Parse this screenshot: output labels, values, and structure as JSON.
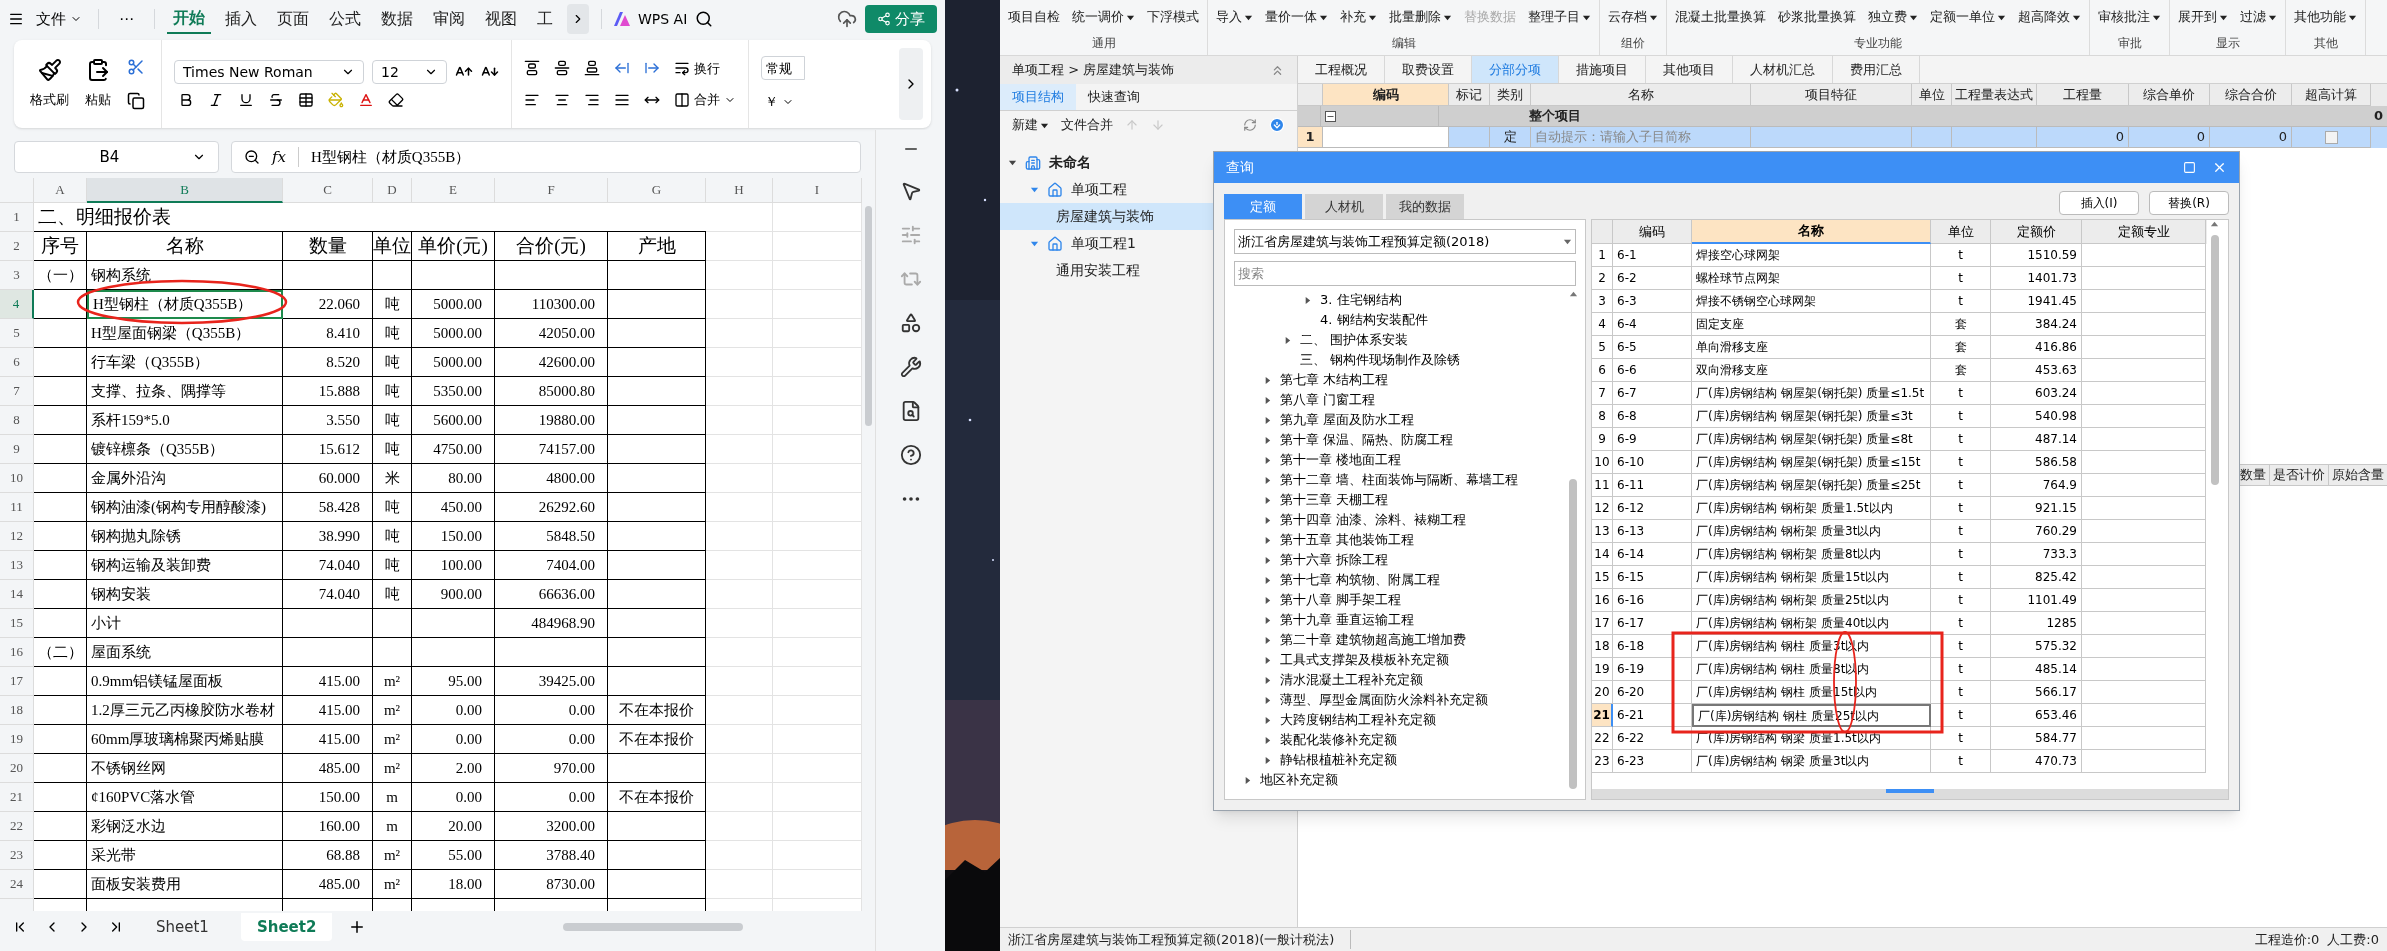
{
  "spreadsheet": {
    "menu": {
      "file": "文件",
      "more": "⋯"
    },
    "tabs": [
      {
        "label": "开始",
        "selected": true
      },
      {
        "label": "插入",
        "selected": false
      },
      {
        "label": "页面",
        "selected": false
      },
      {
        "label": "公式",
        "selected": false
      },
      {
        "label": "数据",
        "selected": false
      },
      {
        "label": "审阅",
        "selected": false
      },
      {
        "label": "视图",
        "selected": false
      },
      {
        "label": "工",
        "selected": false
      }
    ],
    "ai": "WPS AI",
    "share": "分享",
    "ribbon": {
      "format_painter": "格式刷",
      "paste": "粘贴",
      "font": "Times New Roman",
      "size": "12",
      "wrap": "换行",
      "merge": "合并",
      "number_format": "常规",
      "currency": "￥"
    },
    "name_box": "B4",
    "fx": "fx",
    "formula": "H型钢柱（材质Q355B）",
    "columns": [
      {
        "label": "A",
        "selected": false
      },
      {
        "label": "B",
        "selected": true
      },
      {
        "label": "C",
        "selected": false
      },
      {
        "label": "D",
        "selected": false
      },
      {
        "label": "E",
        "selected": false
      },
      {
        "label": "F",
        "selected": false
      },
      {
        "label": "G",
        "selected": false
      },
      {
        "label": "H",
        "selected": false
      },
      {
        "label": "I",
        "selected": false
      }
    ],
    "title_row": {
      "num": "1",
      "title": "二、明细报价表"
    },
    "header_row": {
      "num": "2",
      "seq": "序号",
      "name": "名称",
      "qty": "数量",
      "unit": "单位",
      "price": "单价(元)",
      "total": "合价(元)",
      "origin": "产地"
    },
    "rows": [
      {
        "num": "3",
        "selected": false,
        "seq": "（一）",
        "name": "钢构系统"
      },
      {
        "num": "4",
        "selected": true,
        "name": "H型钢柱（材质Q355B）",
        "qty": "22.060",
        "unit": "吨",
        "price": "5000.00",
        "total": "110300.00"
      },
      {
        "num": "5",
        "selected": false,
        "name": "H型屋面钢梁（Q355B）",
        "qty": "8.410",
        "unit": "吨",
        "price": "5000.00",
        "total": "42050.00"
      },
      {
        "num": "6",
        "selected": false,
        "name": "行车梁（Q355B）",
        "qty": "8.520",
        "unit": "吨",
        "price": "5000.00",
        "total": "42600.00"
      },
      {
        "num": "7",
        "selected": false,
        "name": "支撑、拉条、隅撑等",
        "qty": "15.888",
        "unit": "吨",
        "price": "5350.00",
        "total": "85000.80"
      },
      {
        "num": "8",
        "selected": false,
        "name": "系杆159*5.0",
        "qty": "3.550",
        "unit": "吨",
        "price": "5600.00",
        "total": "19880.00"
      },
      {
        "num": "9",
        "selected": false,
        "name": "镀锌檩条（Q355B）",
        "qty": "15.612",
        "unit": "吨",
        "price": "4750.00",
        "total": "74157.00"
      },
      {
        "num": "10",
        "selected": false,
        "name": "金属外沿沟",
        "qty": "60.000",
        "unit": "米",
        "price": "80.00",
        "total": "4800.00"
      },
      {
        "num": "11",
        "selected": false,
        "name": "钢构油漆(钢构专用醇酸漆)",
        "qty": "58.428",
        "unit": "吨",
        "price": "450.00",
        "total": "26292.60"
      },
      {
        "num": "12",
        "selected": false,
        "name": "钢构抛丸除锈",
        "qty": "38.990",
        "unit": "吨",
        "price": "150.00",
        "total": "5848.50"
      },
      {
        "num": "13",
        "selected": false,
        "name": "钢构运输及装卸费",
        "qty": "74.040",
        "unit": "吨",
        "price": "100.00",
        "total": "7404.00"
      },
      {
        "num": "14",
        "selected": false,
        "name": "钢构安装",
        "qty": "74.040",
        "unit": "吨",
        "price": "900.00",
        "total": "66636.00"
      },
      {
        "num": "15",
        "selected": false,
        "name": "小计",
        "total": "484968.90"
      },
      {
        "num": "16",
        "selected": false,
        "seq": "（二）",
        "name": "屋面系统"
      },
      {
        "num": "17",
        "selected": false,
        "name": "0.9mm铝镁锰屋面板",
        "qty": "415.00",
        "unit": "m²",
        "price": "95.00",
        "total": "39425.00"
      },
      {
        "num": "18",
        "selected": false,
        "name": "1.2厚三元乙丙橡胶防水卷材",
        "qty": "415.00",
        "unit": "m²",
        "price": "0.00",
        "total": "0.00",
        "origin": "不在本报价"
      },
      {
        "num": "19",
        "selected": false,
        "name": "60mm厚玻璃棉聚丙烯贴膜",
        "qty": "415.00",
        "unit": "m²",
        "price": "0.00",
        "total": "0.00",
        "origin": "不在本报价"
      },
      {
        "num": "20",
        "selected": false,
        "name": "不锈钢丝网",
        "qty": "485.00",
        "unit": "m²",
        "price": "2.00",
        "total": "970.00"
      },
      {
        "num": "21",
        "selected": false,
        "name": "¢160PVC落水管",
        "qty": "150.00",
        "unit": "m",
        "price": "0.00",
        "total": "0.00",
        "origin": "不在本报价"
      },
      {
        "num": "22",
        "selected": false,
        "name": "彩钢泛水边",
        "qty": "160.00",
        "unit": "m",
        "price": "20.00",
        "total": "3200.00"
      },
      {
        "num": "23",
        "selected": false,
        "name": "采光带",
        "qty": "68.88",
        "unit": "m²",
        "price": "55.00",
        "total": "3788.40"
      },
      {
        "num": "24",
        "selected": false,
        "name": "面板安装费用",
        "qty": "485.00",
        "unit": "m²",
        "price": "18.00",
        "total": "8730.00"
      }
    ],
    "sheets": [
      {
        "label": "Sheet1",
        "selected": false
      },
      {
        "label": "Sheet2",
        "selected": true
      }
    ]
  },
  "estimator": {
    "ribbon_groups": [
      {
        "label": "通用",
        "buttons": [
          {
            "label": "项目自检",
            "dropdown": false,
            "disabled": false
          },
          {
            "label": "统一调价",
            "dropdown": true,
            "disabled": false
          },
          {
            "label": "下浮模式",
            "dropdown": false,
            "disabled": false
          }
        ]
      },
      {
        "label": "编辑",
        "buttons": [
          {
            "label": "导入",
            "dropdown": true,
            "disabled": false
          },
          {
            "label": "量价一体",
            "dropdown": true,
            "disabled": false
          },
          {
            "label": "补充",
            "dropdown": true,
            "disabled": false
          },
          {
            "label": "批量删除",
            "dropdown": true,
            "disabled": false
          },
          {
            "label": "替换数据",
            "dropdown": false,
            "disabled": true
          },
          {
            "label": "整理子目",
            "dropdown": true,
            "disabled": false
          }
        ]
      },
      {
        "label": "组价",
        "buttons": [
          {
            "label": "云存档",
            "dropdown": true,
            "disabled": false
          }
        ]
      },
      {
        "label": "专业功能",
        "buttons": [
          {
            "label": "混凝土批量换算",
            "dropdown": false,
            "disabled": false
          },
          {
            "label": "砂浆批量换算",
            "dropdown": false,
            "disabled": false
          },
          {
            "label": "独立费",
            "dropdown": true,
            "disabled": false
          },
          {
            "label": "定额一单位",
            "dropdown": true,
            "disabled": false
          },
          {
            "label": "超高降效",
            "dropdown": true,
            "disabled": false
          }
        ]
      },
      {
        "label": "审批",
        "buttons": [
          {
            "label": "审核批注",
            "dropdown": true,
            "disabled": false
          }
        ]
      },
      {
        "label": "显示",
        "buttons": [
          {
            "label": "展开到",
            "dropdown": true,
            "disabled": false
          },
          {
            "label": "过滤",
            "dropdown": true,
            "disabled": false
          }
        ]
      },
      {
        "label": "其他",
        "buttons": [
          {
            "label": "其他功能",
            "dropdown": true,
            "disabled": false
          }
        ]
      }
    ],
    "breadcrumb": "单项工程 > 房屋建筑与装饰",
    "side_tabs": [
      {
        "label": "项目结构",
        "selected": true
      },
      {
        "label": "快速查询",
        "selected": false
      }
    ],
    "side_actions": {
      "new": "新建",
      "merge": "文件合并"
    },
    "tree": [
      {
        "label": "未命名",
        "kind": "root",
        "selected": false,
        "expanded": true,
        "children": [
          {
            "label": "单项工程",
            "kind": "project",
            "selected": false,
            "expanded": true,
            "children": [
              {
                "label": "房屋建筑与装饰",
                "kind": "unit",
                "selected": true
              }
            ]
          },
          {
            "label": "单项工程1",
            "kind": "project",
            "selected": false,
            "expanded": true,
            "children": [
              {
                "label": "通用安装工程",
                "kind": "unit",
                "selected": false
              }
            ]
          }
        ]
      }
    ],
    "tabs": [
      {
        "label": "工程概况",
        "selected": false
      },
      {
        "label": "取费设置",
        "selected": false
      },
      {
        "label": "分部分项",
        "selected": true
      },
      {
        "label": "措施项目",
        "selected": false
      },
      {
        "label": "其他项目",
        "selected": false
      },
      {
        "label": "人材机汇总",
        "selected": false
      },
      {
        "label": "费用汇总",
        "selected": false
      }
    ],
    "grid": {
      "columns": [
        "编码",
        "标记",
        "类别",
        "名称",
        "项目特征",
        "单位",
        "工程量表达式",
        "工程量",
        "综合单价",
        "综合合价",
        "超高计算"
      ],
      "rows": [
        {
          "kind": "group",
          "selected": false,
          "name": "整个项目",
          "total": "0"
        },
        {
          "kind": "item",
          "selected": true,
          "num": "1",
          "type": "定",
          "name": "自动提示：请输入子目简称",
          "qty": "0",
          "price": "0",
          "total": "0",
          "checked": false
        }
      ]
    },
    "lower_columns": [
      "数量",
      "是否计价",
      "原始含量"
    ],
    "status": {
      "left": "浙江省房屋建筑与装饰工程预算定额(2018)(一般计税法)",
      "right": [
        "工程造价:0",
        "人工费:0"
      ]
    },
    "dialog": {
      "title": "查询",
      "tabs": [
        {
          "label": "定额",
          "selected": true
        },
        {
          "label": "人材机",
          "selected": false
        },
        {
          "label": "我的数据",
          "selected": false
        }
      ],
      "buttons": [
        "插入(I)",
        "替换(R)"
      ],
      "library": "浙江省房屋建筑与装饰工程预算定额(2018)",
      "search": {
        "placeholder": "搜索"
      },
      "tree": [
        {
          "children": [
            {
              "children": [
                {
                  "children": [
                    {
                      "label": "3. 住宅钢结构",
                      "expanded": false
                    },
                    {
                      "label": "4. 钢结构安装配件"
                    }
                  ]
                },
                {
                  "label": "二、 围护体系安装",
                  "expanded": false
                },
                {
                  "label": "三、 钢构件现场制作及除锈"
                }
              ]
            },
            {
              "label": "第七章 木结构工程",
              "expanded": false
            },
            {
              "label": "第八章 门窗工程",
              "expanded": false
            },
            {
              "label": "第九章 屋面及防水工程",
              "expanded": false
            },
            {
              "label": "第十章 保温、隔热、防腐工程",
              "expanded": false
            },
            {
              "label": "第十一章 楼地面工程",
              "expanded": false
            },
            {
              "label": "第十二章 墙、柱面装饰与隔断、幕墙工程",
              "expanded": false
            },
            {
              "label": "第十三章 天棚工程",
              "expanded": false
            },
            {
              "label": "第十四章 油漆、涂料、裱糊工程",
              "expanded": false
            },
            {
              "label": "第十五章 其他装饰工程",
              "expanded": false
            },
            {
              "label": "第十六章 拆除工程",
              "expanded": false
            },
            {
              "label": "第十七章 构筑物、附属工程",
              "expanded": false
            },
            {
              "label": "第十八章 脚手架工程",
              "expanded": false
            },
            {
              "label": "第十九章 垂直运输工程",
              "expanded": false
            },
            {
              "label": "第二十章 建筑物超高施工增加费",
              "expanded": false
            },
            {
              "label": "工具式支撑架及模板补充定额",
              "expanded": false
            },
            {
              "label": "清水混凝土工程补充定额",
              "expanded": false
            },
            {
              "label": "薄型、厚型金属面防火涂料补充定额",
              "expanded": false
            },
            {
              "label": "大跨度钢结构工程补充定额",
              "expanded": false
            },
            {
              "label": "装配化装修补充定额",
              "expanded": false
            },
            {
              "label": "静钻根植桩补充定额",
              "expanded": false
            }
          ]
        },
        {
          "label": "地区补充定额",
          "expanded": false
        }
      ],
      "columns": [
        {
          "label": "编码",
          "selected": false
        },
        {
          "label": "名称",
          "selected": true
        },
        {
          "label": "单位",
          "selected": false
        },
        {
          "label": "定额价",
          "selected": false
        },
        {
          "label": "定额专业",
          "selected": false
        }
      ],
      "rows": [
        {
          "num": "1",
          "selected": false,
          "code": "6-1",
          "name": "焊接空心球网架",
          "unit": "t",
          "price": "1510.59"
        },
        {
          "num": "2",
          "selected": false,
          "code": "6-2",
          "name": "螺栓球节点网架",
          "unit": "t",
          "price": "1401.73"
        },
        {
          "num": "3",
          "selected": false,
          "code": "6-3",
          "name": "焊接不锈钢空心球网架",
          "unit": "t",
          "price": "1941.45"
        },
        {
          "num": "4",
          "selected": false,
          "code": "6-4",
          "name": "固定支座",
          "unit": "套",
          "price": "384.24"
        },
        {
          "num": "5",
          "selected": false,
          "code": "6-5",
          "name": "单向滑移支座",
          "unit": "套",
          "price": "416.86"
        },
        {
          "num": "6",
          "selected": false,
          "code": "6-6",
          "name": "双向滑移支座",
          "unit": "套",
          "price": "453.63"
        },
        {
          "num": "7",
          "selected": false,
          "code": "6-7",
          "name": "厂(库)房钢结构 钢屋架(钢托架) 质量≤1.5t",
          "unit": "t",
          "price": "603.24"
        },
        {
          "num": "8",
          "selected": false,
          "code": "6-8",
          "name": "厂(库)房钢结构 钢屋架(钢托架) 质量≤3t",
          "unit": "t",
          "price": "540.98"
        },
        {
          "num": "9",
          "selected": false,
          "code": "6-9",
          "name": "厂(库)房钢结构 钢屋架(钢托架) 质量≤8t",
          "unit": "t",
          "price": "487.14"
        },
        {
          "num": "10",
          "selected": false,
          "code": "6-10",
          "name": "厂(库)房钢结构 钢屋架(钢托架) 质量≤15t",
          "unit": "t",
          "price": "586.58"
        },
        {
          "num": "11",
          "selected": false,
          "code": "6-11",
          "name": "厂(库)房钢结构 钢屋架(钢托架) 质量≤25t",
          "unit": "t",
          "price": "764.9"
        },
        {
          "num": "12",
          "selected": false,
          "code": "6-12",
          "name": "厂(库)房钢结构 钢桁架 质量1.5t以内",
          "unit": "t",
          "price": "921.15"
        },
        {
          "num": "13",
          "selected": false,
          "code": "6-13",
          "name": "厂(库)房钢结构 钢桁架 质量3t以内",
          "unit": "t",
          "price": "760.29"
        },
        {
          "num": "14",
          "selected": false,
          "code": "6-14",
          "name": "厂(库)房钢结构 钢桁架 质量8t以内",
          "unit": "t",
          "price": "733.3"
        },
        {
          "num": "15",
          "selected": false,
          "code": "6-15",
          "name": "厂(库)房钢结构 钢桁架 质量15t以内",
          "unit": "t",
          "price": "825.42"
        },
        {
          "num": "16",
          "selected": false,
          "code": "6-16",
          "name": "厂(库)房钢结构 钢桁架 质量25t以内",
          "unit": "t",
          "price": "1101.49"
        },
        {
          "num": "17",
          "selected": false,
          "code": "6-17",
          "name": "厂(库)房钢结构 钢桁架 质量40t以内",
          "unit": "t",
          "price": "1285"
        },
        {
          "num": "18",
          "selected": false,
          "code": "6-18",
          "name": "厂(库)房钢结构 钢柱 质量3t以内",
          "unit": "t",
          "price": "575.32"
        },
        {
          "num": "19",
          "selected": false,
          "code": "6-19",
          "name": "厂(库)房钢结构 钢柱 质量8t以内",
          "unit": "t",
          "price": "485.14"
        },
        {
          "num": "20",
          "selected": false,
          "code": "6-20",
          "name": "厂(库)房钢结构 钢柱 质量15t以内",
          "unit": "t",
          "price": "566.17"
        },
        {
          "num": "21",
          "selected": true,
          "code": "6-21",
          "name": "厂(库)房钢结构 钢柱 质量25t以内",
          "unit": "t",
          "price": "653.46"
        },
        {
          "num": "22",
          "selected": false,
          "code": "6-22",
          "name": "厂(库)房钢结构 钢梁 质量1.5t以内",
          "unit": "t",
          "price": "584.77"
        },
        {
          "num": "23",
          "selected": false,
          "code": "6-23",
          "name": "厂(库)房钢结构 钢梁 质量3t以内",
          "unit": "t",
          "price": "470.73"
        }
      ]
    }
  }
}
